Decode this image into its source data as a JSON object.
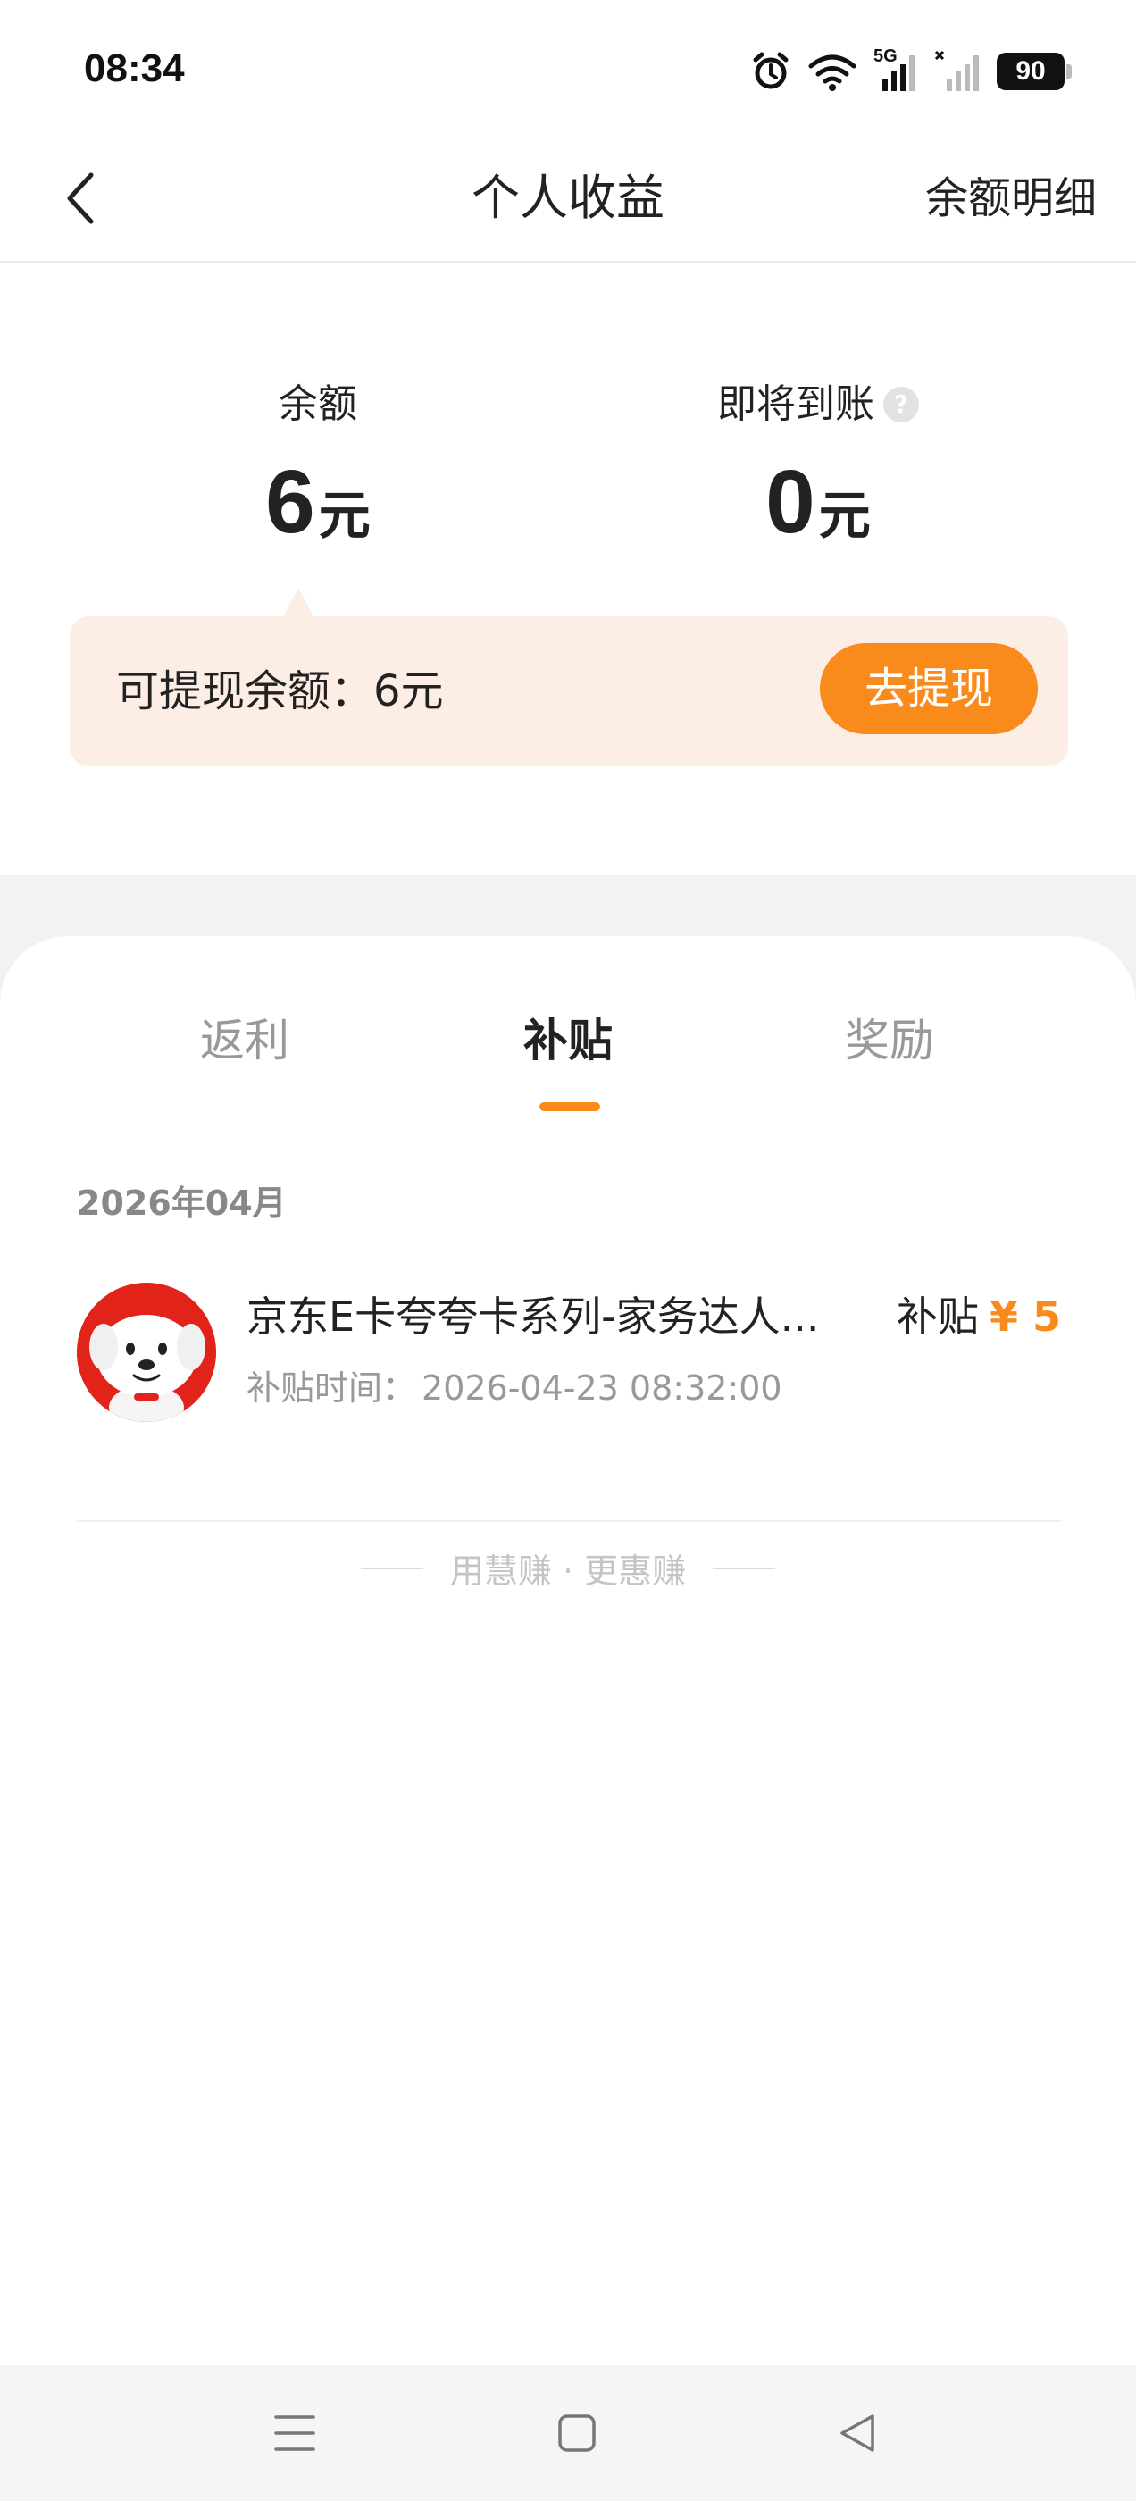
{
  "status_bar": {
    "time": "08:34",
    "network": "5G",
    "battery": "90",
    "icons": [
      "alarm-icon",
      "wifi-icon",
      "signal-5g-icon",
      "signal-no-service-icon",
      "battery-icon"
    ]
  },
  "nav": {
    "back_icon": "chevron-left-icon",
    "title": "个人收益",
    "right_link": "余额明细"
  },
  "summary": {
    "balance_label": "余额",
    "balance_value": "6",
    "balance_unit": "元",
    "pending_label": "即将到账",
    "pending_help": "?",
    "pending_value": "0",
    "pending_unit": "元",
    "withdrawable_text": "可提现余额：6元",
    "withdraw_button": "去提现"
  },
  "tabs": [
    {
      "label": "返利",
      "active": false
    },
    {
      "label": "补贴",
      "active": true
    },
    {
      "label": "奖励",
      "active": false
    }
  ],
  "records": {
    "month": "2026年04月",
    "items": [
      {
        "avatar_icon": "jd-dog-avatar-icon",
        "title": "京东E卡夸夸卡系列-家务达人...",
        "time_label": "补贴时间：",
        "time_value": "2026-04-23 08:32:00",
        "amount_label": "补贴",
        "amount_value": "¥ 5"
      }
    ]
  },
  "footer_tagline": "用慧赚 · 更惠赚",
  "system_nav": {
    "menu_icon": "menu-icon",
    "home_icon": "home-square-icon",
    "back_icon": "back-triangle-icon"
  },
  "colors": {
    "accent": "#f98a1c",
    "withdraw_bg": "#fdeee5",
    "page_bg": "#f2f2f2"
  }
}
